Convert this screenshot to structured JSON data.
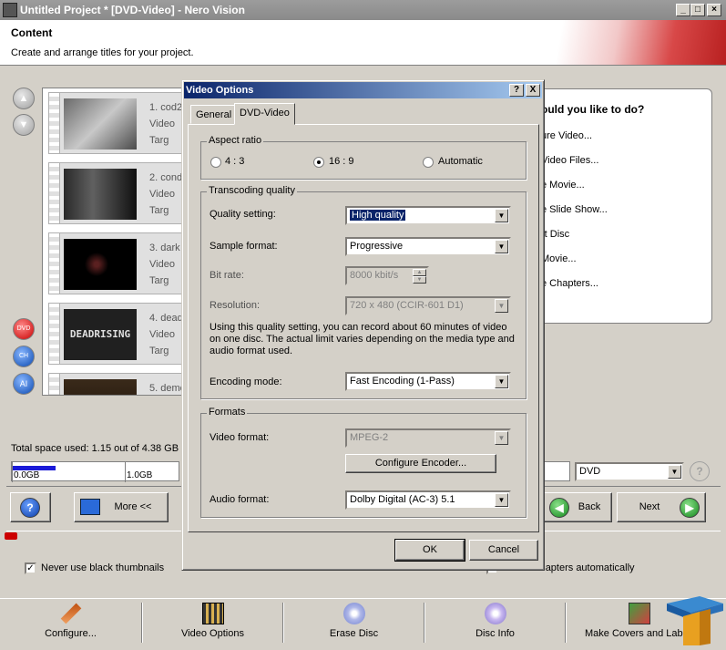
{
  "window": {
    "title": "Untitled Project * [DVD-Video] - Nero Vision"
  },
  "header": {
    "title": "Content",
    "subtitle": "Create and arrange titles for your project."
  },
  "titles": [
    {
      "name": "1. cod2",
      "line2": "Video",
      "line3": "Targ"
    },
    {
      "name": "2. cond",
      "line2": "Video",
      "line3": "Targ"
    },
    {
      "name": "3. dark",
      "line2": "Video",
      "line3": "Targ"
    },
    {
      "name": "4. dead",
      "line2": "Video",
      "line3": "Targ"
    },
    {
      "name": "5. demo",
      "line2": "",
      "line3": ""
    }
  ],
  "thumb4_text": "DEADRISING",
  "side_icons": {
    "burn": "DVD",
    "chapter": "CH",
    "text": "AI"
  },
  "right_panel": {
    "question": "ould you like to do?",
    "options": [
      "ure Video...",
      "Video Files...",
      "e Movie...",
      "e Slide Show...",
      "rt Disc",
      "Movie...",
      "e Chapters..."
    ]
  },
  "space": {
    "text": "Total space used: 1.15 out of 4.38 GB",
    "ticks": [
      "0.0GB",
      "1.0GB"
    ],
    "used_fraction": 0.26
  },
  "disc_type": "DVD",
  "nav": {
    "more": "More <<",
    "back": "Back",
    "next": "Next"
  },
  "never_black": "Never use black thumbnails",
  "create_chapters": "Create chapters automatically",
  "footer": [
    "Configure...",
    "Video Options",
    "Erase Disc",
    "Disc Info",
    "Make Covers and Labels"
  ],
  "dialog": {
    "title": "Video Options",
    "help": "?",
    "close": "X",
    "tabs": [
      "General",
      "DVD-Video"
    ],
    "aspect": {
      "label": "Aspect ratio",
      "options": [
        "4 : 3",
        "16 : 9",
        "Automatic"
      ],
      "selected": "16 : 9"
    },
    "transcoding": {
      "label": "Transcoding quality",
      "quality_label": "Quality setting:",
      "quality_value": "High quality",
      "sample_label": "Sample format:",
      "sample_value": "Progressive",
      "bitrate_label": "Bit rate:",
      "bitrate_value": "8000 kbit/s",
      "resolution_label": "Resolution:",
      "resolution_value": "720 x 480 (CCIR-601 D1)",
      "note": "Using this quality setting, you can record about 60 minutes of video on one disc. The actual limit varies depending on the media type and audio format used.",
      "encoding_label": "Encoding mode:",
      "encoding_value": "Fast Encoding (1-Pass)"
    },
    "formats": {
      "label": "Formats",
      "video_label": "Video format:",
      "video_value": "MPEG-2",
      "configure": "Configure Encoder...",
      "audio_label": "Audio format:",
      "audio_value": "Dolby Digital (AC-3) 5.1"
    },
    "ok": "OK",
    "cancel": "Cancel"
  }
}
